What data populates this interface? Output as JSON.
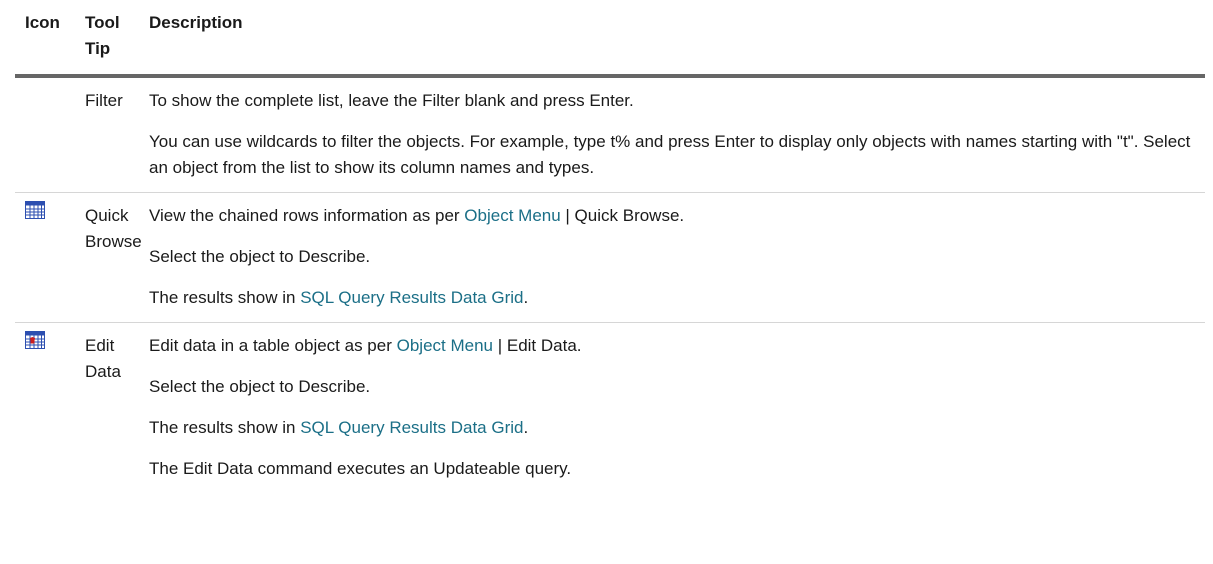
{
  "header": {
    "icon_label": "Icon",
    "tooltip_label": "Tool Tip",
    "description_label": "Description"
  },
  "rows": [
    {
      "icon": "none",
      "tooltip": "Filter",
      "paragraphs": [
        {
          "text": "To show the complete list, leave the Filter blank and press Enter."
        },
        {
          "text": "You can use wildcards to filter the objects. For example, type t% and press Enter to display only objects with names starting with \"t\". Select an object from the list to show its column names and types."
        }
      ]
    },
    {
      "icon": "grid-table-icon",
      "tooltip": "Quick Browse",
      "paragraphs": [
        {
          "before": "View the chained rows information as per ",
          "link": "Object Menu",
          "after": " | Quick Browse."
        },
        {
          "text": "Select the object to Describe."
        },
        {
          "before": "The results show in ",
          "link": "SQL Query Results Data Grid",
          "after": "."
        }
      ]
    },
    {
      "icon": "edit-grid-icon",
      "tooltip": "Edit Data",
      "paragraphs": [
        {
          "before": "Edit data in a table object as per ",
          "link": "Object Menu",
          "after": " | Edit Data."
        },
        {
          "text": "Select the object to Describe."
        },
        {
          "before": "The results show in ",
          "link": "SQL Query Results Data Grid",
          "after": "."
        },
        {
          "text": "The Edit Data command executes an Updateable query."
        }
      ]
    }
  ],
  "colors": {
    "link": "#1b6f87",
    "header_rule": "#666666",
    "row_rule": "#d6d6d6",
    "icon_blue": "#2d4fb0",
    "icon_red": "#cc1f1f"
  }
}
